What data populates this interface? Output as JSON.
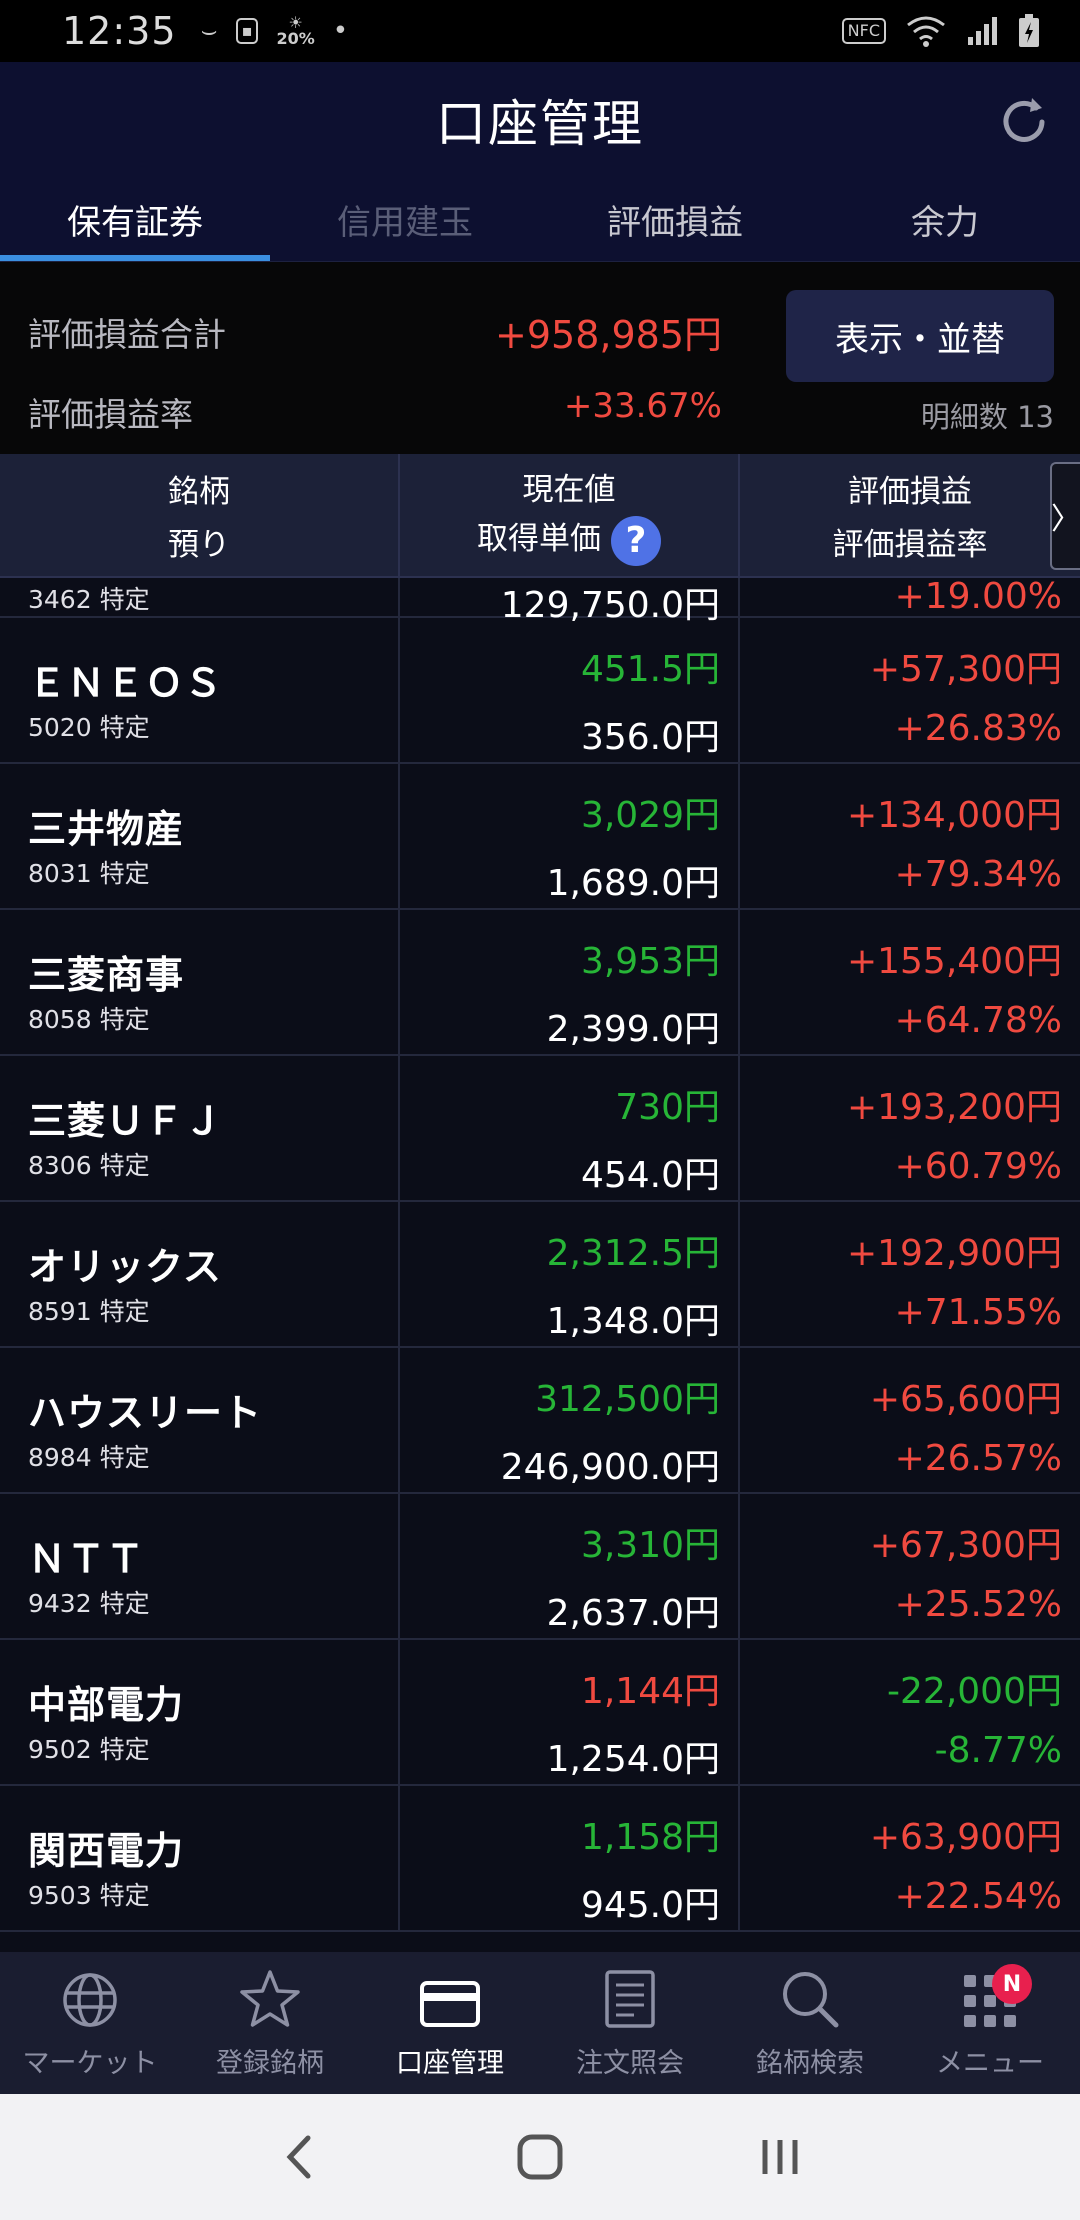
{
  "status_bar": {
    "time": "12:35",
    "weather_percent": "20%",
    "nfc_label": "NFC"
  },
  "header": {
    "title": "口座管理"
  },
  "tabs": [
    {
      "label": "保有証券"
    },
    {
      "label": "信用建玉"
    },
    {
      "label": "評価損益"
    },
    {
      "label": "余力"
    }
  ],
  "summary": {
    "total_label": "評価損益合計",
    "total_value": "+958,985円",
    "rate_label": "評価損益率",
    "rate_value": "+33.67%",
    "sort_button": "表示・並替",
    "count_text": "明細数 13"
  },
  "table_header": {
    "col1_top": "銘柄",
    "col1_bottom": "預り",
    "col2_top": "現在値",
    "col2_bottom": "取得単価",
    "help_icon": "?",
    "col3_top": "評価損益",
    "col3_bottom": "評価損益率",
    "more_arrow": "〉"
  },
  "partial_row": {
    "code": "3462 特定",
    "acq": "129,750.0円",
    "rate": "+19.00%"
  },
  "holdings": [
    {
      "name": "ＥＮＥＯＳ",
      "code": "5020 特定",
      "price": "451.5円",
      "acq": "356.0円",
      "pl": "+57,300円",
      "rate": "+26.83%",
      "price_color": "green",
      "pl_color": "red"
    },
    {
      "name": "三井物産",
      "code": "8031 特定",
      "price": "3,029円",
      "acq": "1,689.0円",
      "pl": "+134,000円",
      "rate": "+79.34%",
      "price_color": "green",
      "pl_color": "red"
    },
    {
      "name": "三菱商事",
      "code": "8058 特定",
      "price": "3,953円",
      "acq": "2,399.0円",
      "pl": "+155,400円",
      "rate": "+64.78%",
      "price_color": "green",
      "pl_color": "red"
    },
    {
      "name": "三菱ＵＦＪ",
      "code": "8306 特定",
      "price": "730円",
      "acq": "454.0円",
      "pl": "+193,200円",
      "rate": "+60.79%",
      "price_color": "green",
      "pl_color": "red"
    },
    {
      "name": "オリックス",
      "code": "8591 特定",
      "price": "2,312.5円",
      "acq": "1,348.0円",
      "pl": "+192,900円",
      "rate": "+71.55%",
      "price_color": "green",
      "pl_color": "red"
    },
    {
      "name": "ハウスリート",
      "code": "8984 特定",
      "price": "312,500円",
      "acq": "246,900.0円",
      "pl": "+65,600円",
      "rate": "+26.57%",
      "price_color": "green",
      "pl_color": "red"
    },
    {
      "name": "ＮＴＴ",
      "code": "9432 特定",
      "price": "3,310円",
      "acq": "2,637.0円",
      "pl": "+67,300円",
      "rate": "+25.52%",
      "price_color": "green",
      "pl_color": "red"
    },
    {
      "name": "中部電力",
      "code": "9502 特定",
      "price": "1,144円",
      "acq": "1,254.0円",
      "pl": "-22,000円",
      "rate": "-8.77%",
      "price_color": "red",
      "pl_color": "green"
    },
    {
      "name": "関西電力",
      "code": "9503 特定",
      "price": "1,158円",
      "acq": "945.0円",
      "pl": "+63,900円",
      "rate": "+22.54%",
      "price_color": "green",
      "pl_color": "red"
    }
  ],
  "bottom_nav": [
    {
      "label": "マーケット",
      "icon": "globe-icon"
    },
    {
      "label": "登録銘柄",
      "icon": "star-icon"
    },
    {
      "label": "口座管理",
      "icon": "card-icon"
    },
    {
      "label": "注文照会",
      "icon": "document-icon"
    },
    {
      "label": "銘柄検索",
      "icon": "search-icon"
    },
    {
      "label": "メニュー",
      "icon": "grid-icon",
      "badge": "N"
    }
  ],
  "colors": {
    "header_bg": "#0d1030",
    "tab_indicator": "#3b8fe0",
    "gain": "#f04a40",
    "loss": "#27b537",
    "help_blue": "#4f72e6",
    "badge": "#e8204e"
  }
}
